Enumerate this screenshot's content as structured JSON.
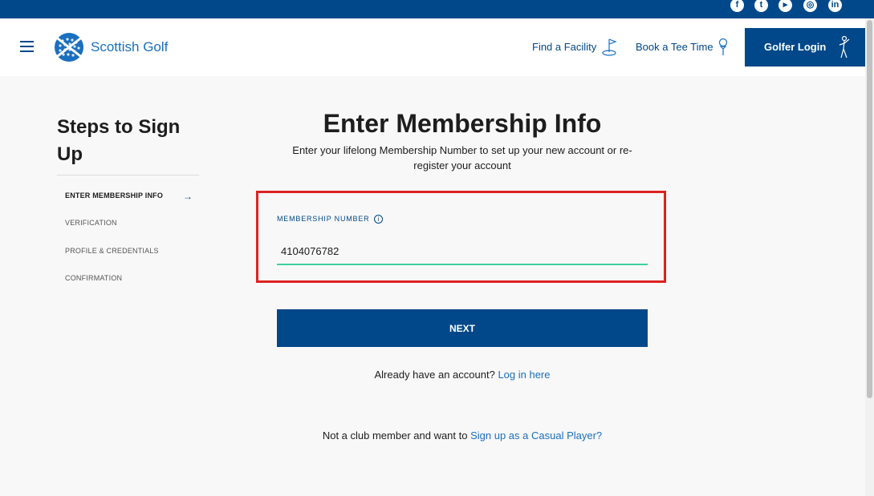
{
  "header": {
    "brand": "Scottish Golf",
    "nav": {
      "find_facility": "Find a Facility",
      "book_tee_time": "Book a Tee Time"
    },
    "login_button": "Golfer Login",
    "social_icons": [
      "facebook-icon",
      "twitter-icon",
      "youtube-icon",
      "instagram-icon",
      "linkedin-icon"
    ]
  },
  "sidebar": {
    "title": "Steps to Sign Up",
    "steps": [
      {
        "label": "ENTER MEMBERSHIP INFO",
        "active": true
      },
      {
        "label": "VERIFICATION",
        "active": false
      },
      {
        "label": "PROFILE & CREDENTIALS",
        "active": false
      },
      {
        "label": "CONFIRMATION",
        "active": false
      }
    ]
  },
  "main": {
    "title": "Enter Membership Info",
    "subtitle": "Enter your lifelong Membership Number to set up your new account or re-register your account",
    "field_label": "MEMBERSHIP NUMBER",
    "field_value": "4104076782",
    "next_button": "NEXT",
    "login_prompt": "Already have an account?",
    "login_link": "Log in here",
    "casual_prompt": "Not a club member and want to",
    "casual_link": "Sign up as a Casual Player?"
  },
  "colors": {
    "brand_blue": "#00488a",
    "link_blue": "#1a6fbf",
    "input_underline": "#3fd0a0",
    "highlight_red": "#dd2222"
  }
}
